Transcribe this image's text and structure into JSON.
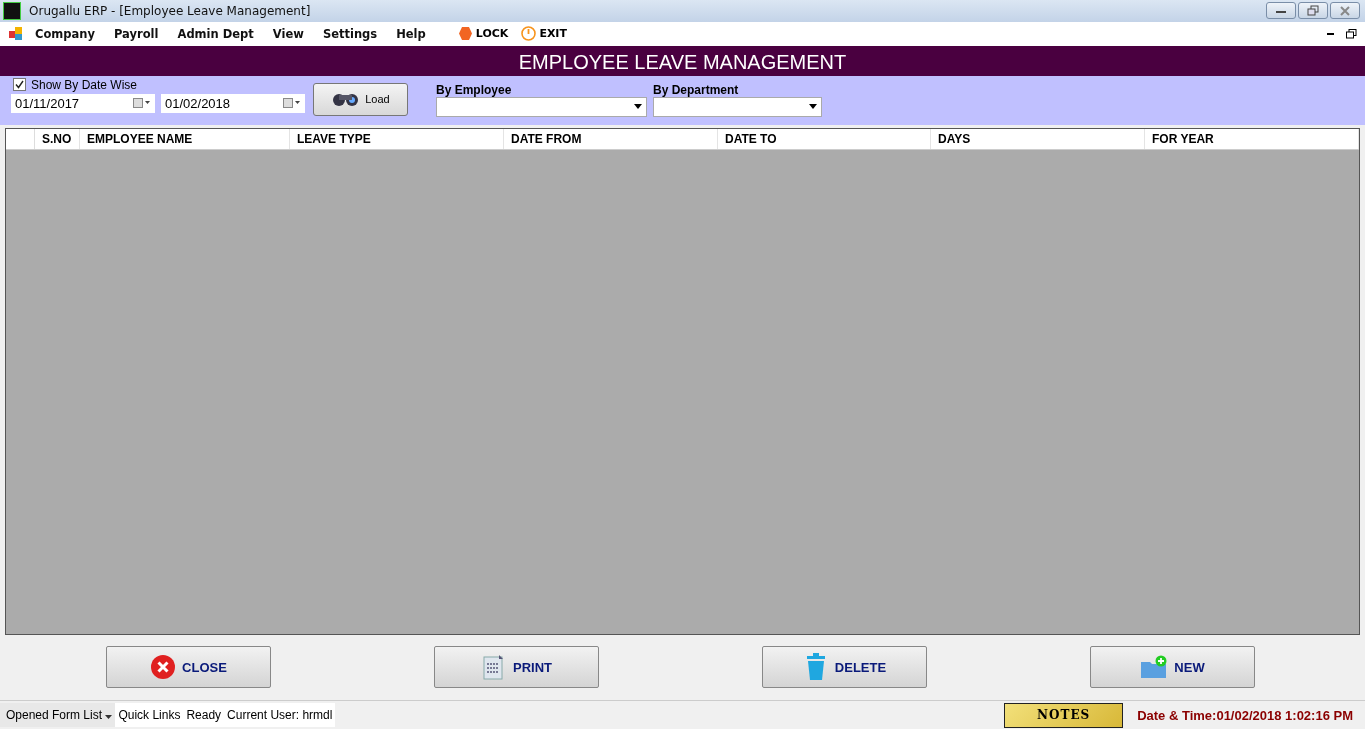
{
  "window": {
    "title": "Orugallu ERP - [Employee Leave Management]"
  },
  "menu": [
    "Company",
    "Payroll",
    "Admin Dept",
    "View",
    "Settings",
    "Help"
  ],
  "menu_actions": [
    {
      "label": "LOCK",
      "kind": "lock"
    },
    {
      "label": "EXIT",
      "kind": "exit"
    }
  ],
  "header": "EMPLOYEE LEAVE MANAGEMENT",
  "filters": {
    "date_wise": {
      "label": "Show By Date Wise",
      "checked": true
    },
    "date_from": "01/11/2017",
    "date_to": "01/02/2018",
    "load": "Load",
    "by_employee": "By Employee",
    "by_department": "By Department"
  },
  "table": {
    "columns": [
      "S.NO",
      "EMPLOYEE NAME",
      "LEAVE TYPE",
      "DATE FROM",
      "DATE TO",
      "DAYS",
      "FOR YEAR"
    ]
  },
  "buttons": [
    {
      "label": "CLOSE",
      "kind": "close"
    },
    {
      "label": "PRINT",
      "kind": "print"
    },
    {
      "label": "DELETE",
      "kind": "delete"
    },
    {
      "label": "NEW",
      "kind": "new"
    }
  ],
  "status_bar": {
    "form_list": "Opened Form List",
    "quick_links": "Quick Links",
    "status": "Ready",
    "user": "Current User: hrmdl",
    "notes": "NOTES",
    "datetime": "Date & Time:01/02/2018 1:02:16 PM"
  }
}
